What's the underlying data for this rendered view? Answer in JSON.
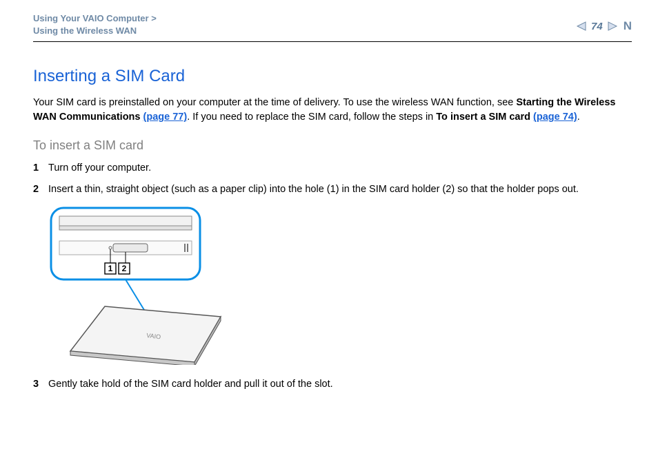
{
  "breadcrumb": {
    "line1": "Using Your VAIO Computer",
    "chev": ">",
    "line2": "Using the Wireless WAN"
  },
  "page": {
    "number": "74",
    "prev_icon": "prev-page",
    "next_icon": "next-page"
  },
  "section": {
    "title": "Inserting a SIM Card",
    "intro_plain1": "Your SIM card is preinstalled on your computer at the time of delivery. To use the wireless WAN function, see ",
    "intro_bold1": "Starting the Wireless WAN Communications ",
    "intro_link1": "(page 77)",
    "intro_plain2": ". If you need to replace the SIM card, follow the steps in ",
    "intro_bold2": "To insert a SIM card ",
    "intro_link2": "(page 74)",
    "intro_plain3": "."
  },
  "subheading": "To insert a SIM card",
  "steps": [
    {
      "n": "1",
      "text": "Turn off your computer."
    },
    {
      "n": "2",
      "text": "Insert a thin, straight object (such as a paper clip) into the hole (1) in the SIM card holder (2) so that the holder pops out."
    },
    {
      "n": "3",
      "text": "Gently take hold of the SIM card holder and pull it out of the slot."
    }
  ],
  "figure": {
    "callout_1": "1",
    "callout_2": "2",
    "brand": "VAIO"
  }
}
